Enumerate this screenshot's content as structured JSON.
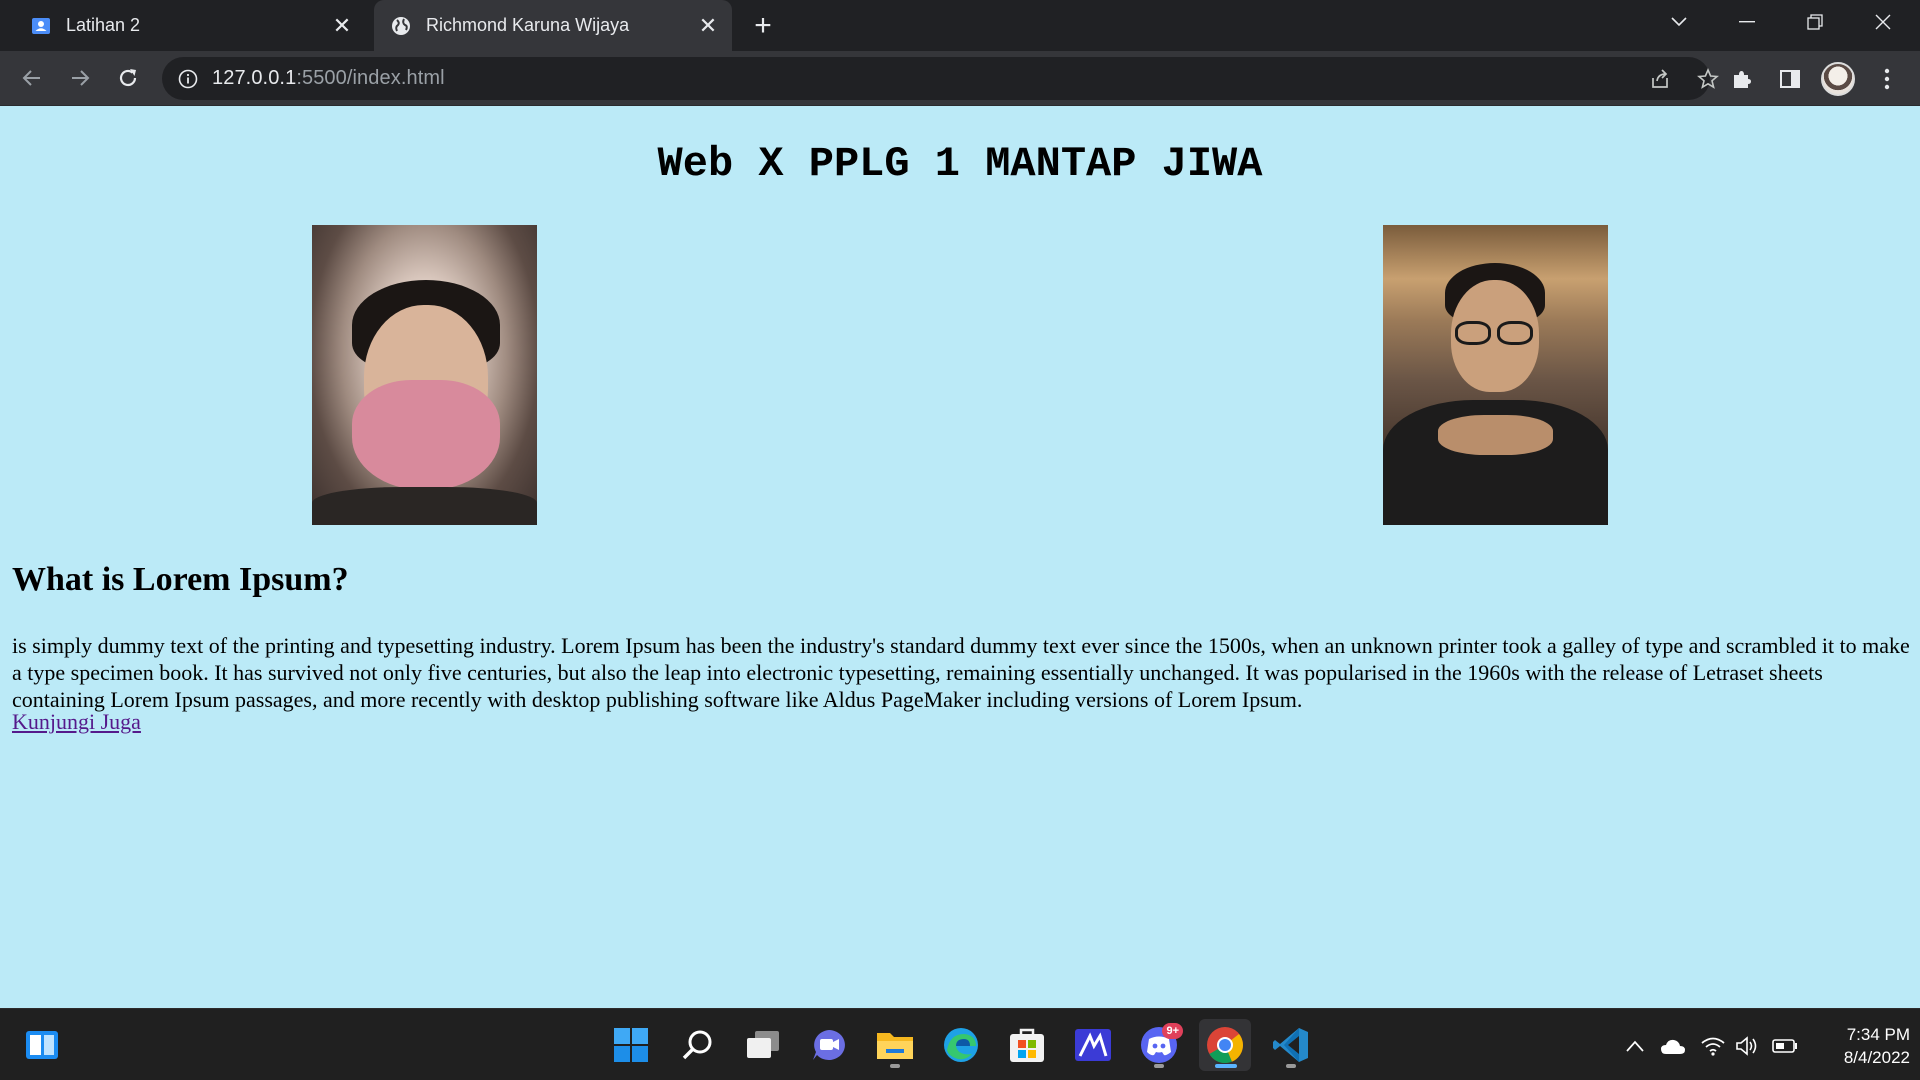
{
  "browser": {
    "tabs": [
      {
        "title": "Latihan 2",
        "active": false,
        "icon": "classroom-icon"
      },
      {
        "title": "Richmond Karuna Wijaya",
        "active": true,
        "icon": "globe-icon"
      }
    ],
    "address": {
      "host": "127.0.0.1",
      "path": ":5500/index.html"
    }
  },
  "page": {
    "title": "Web X PPLG 1 MANTAP JIWA",
    "heading": "What is Lorem Ipsum?",
    "paragraph": "is simply dummy text of the printing and typesetting industry. Lorem Ipsum has been the industry's standard dummy text ever since the 1500s, when an unknown printer took a galley of type and scrambled it to make a type specimen book. It has survived not only five centuries, but also the leap into electronic typesetting, remaining essentially unchanged. It was popularised in the 1960s with the release of Letraset sheets containing Lorem Ipsum passages, and more recently with desktop publishing software like Aldus PageMaker including versions of Lorem Ipsum.",
    "link": "Kunjungi Juga",
    "background_color": "#bbeaf7",
    "link_color": "#551a8b"
  },
  "taskbar": {
    "apps": [
      "widgets-icon",
      "start-icon",
      "search-icon",
      "task-view-icon",
      "teams-chat-icon",
      "file-explorer-icon",
      "edge-icon",
      "store-icon",
      "app-icon",
      "discord-icon",
      "chrome-icon",
      "vscode-icon"
    ],
    "discord_badge": "9+",
    "time": "7:34 PM",
    "date": "8/4/2022"
  }
}
